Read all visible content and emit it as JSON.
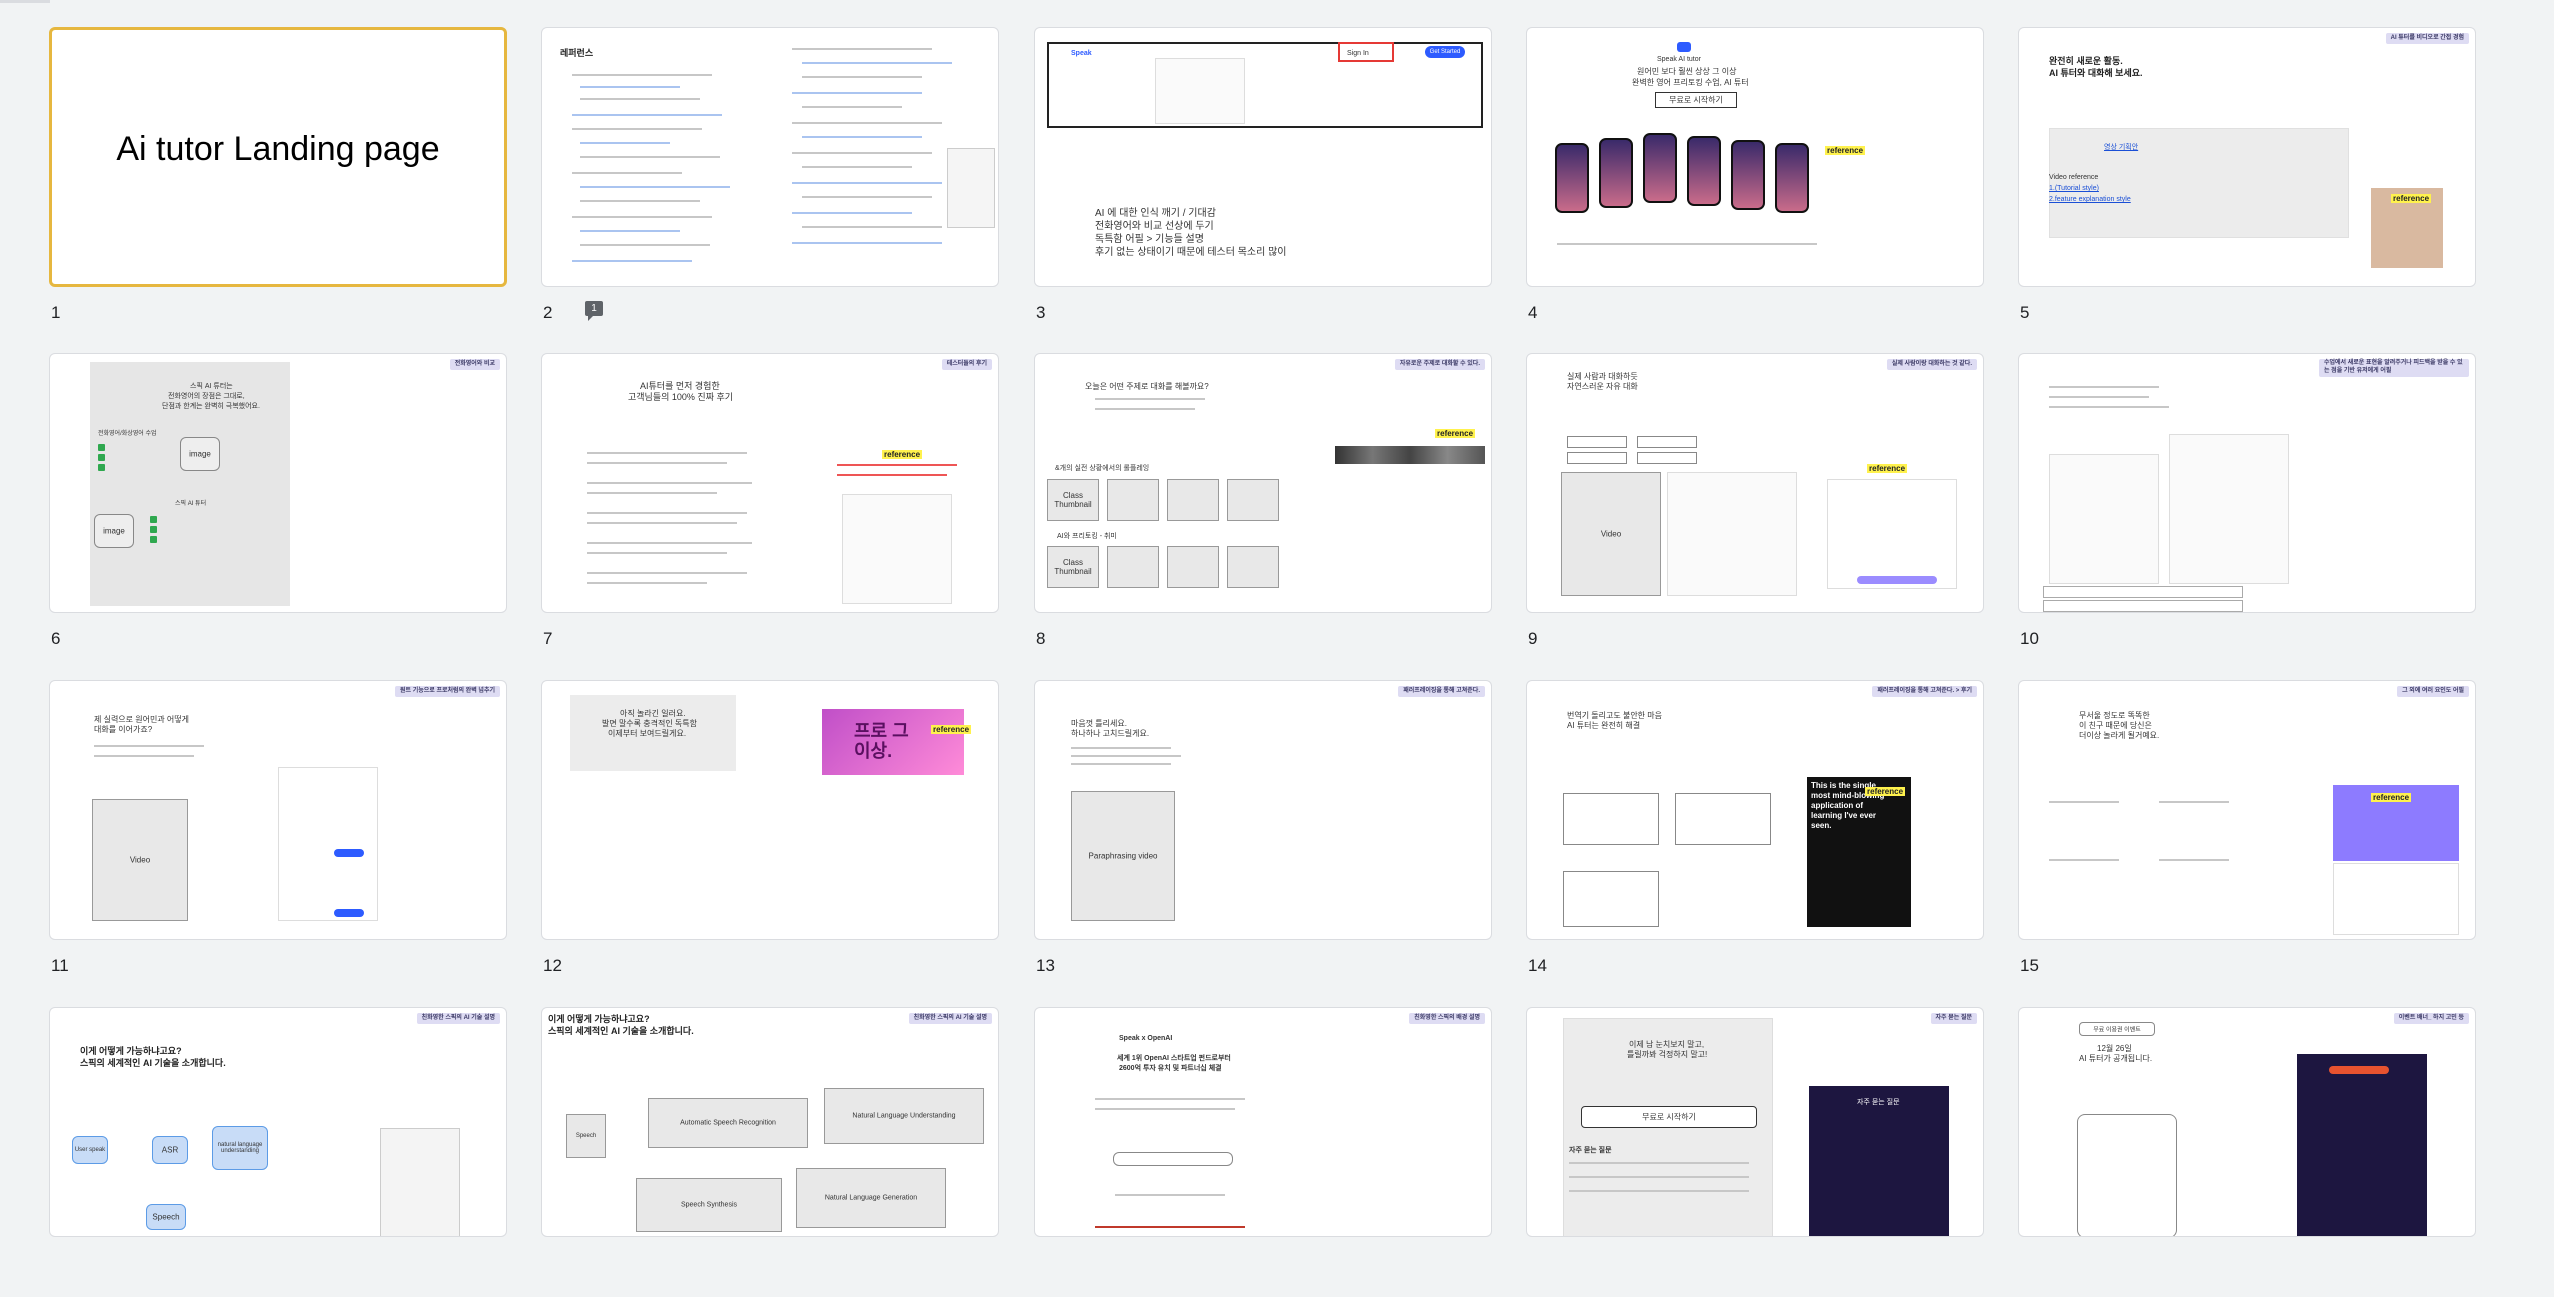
{
  "slides": [
    {
      "num": "1",
      "title": "Ai tutor Landing page"
    },
    {
      "num": "2",
      "heading": "레퍼런스",
      "comment_count": "1"
    },
    {
      "num": "3",
      "lines": [
        "AI 에 대한 인식 깨기 / 기대감",
        "전화영어와 비교 선상에 두기",
        "독특함 어필 > 기능들 설명",
        "후기 없는 상태이기 때문에 테스터 목소리 많이"
      ],
      "nav": [
        "Speak",
        "Sign In",
        "Get Started"
      ]
    },
    {
      "num": "4",
      "brand": "Speak AI tutor",
      "headline1": "원어민 보다 훨씬 상상 그 이상",
      "headline2": "완벽한 영어 프리토킹 수업, AI 튜터",
      "cta": "무료로 시작하기",
      "ref": "reference"
    },
    {
      "num": "5",
      "tag": "AI 튜터를 비디오로 간접 경험",
      "h1": "완전히 새로운 활동.",
      "h2": "AI 튜터와 대화해 보세요.",
      "video_link": "영상 기획안",
      "video_ref": "Video reference",
      "ref1": "1.(Tutorial style)",
      "ref2": "2.feature explanation style",
      "ref": "reference"
    },
    {
      "num": "6",
      "tag": "전화영어와 비교",
      "h1": "스픽 AI 튜터는",
      "h2": "전화영어의 장점은 그대로,",
      "h3": "단점과 한계는 완벽히 극복했어요.",
      "sub1": "전화영어/화상영어 수업",
      "sub2": "스픽 AI 튜터",
      "image": "image"
    },
    {
      "num": "7",
      "tag": "테스터들의 후기",
      "h1": "AI튜터를 먼저 경험한",
      "h2": "고객님들의 100% 진짜 후기",
      "ref": "reference"
    },
    {
      "num": "8",
      "tag": "자유로운 주제로 대화할 수 있다.",
      "h1": "오늘은 어떤 주제로 대화를 해볼까요?",
      "sub": "&개의 실전 상황에서의 롤플레잉",
      "sub2": "AI와 프리토킹 - 취미",
      "thumb": "Class Thumbnail",
      "ref": "reference"
    },
    {
      "num": "9",
      "tag": "실제 사람이랑 대화하는 것 같다.",
      "h1": "실제 사람과 대화하듯",
      "h2": "자연스러운 자유 대화",
      "video": "Video",
      "ref": "reference"
    },
    {
      "num": "10",
      "tag": "수업에서 새로운 표현을 알려주거나 피드백을 받을 수 있는 점을 기반 유저에게 어필"
    },
    {
      "num": "11",
      "tag": "원트 기능으로 프로처럼의 완벽 넘추기",
      "h1": "제 실력으로 원어민과 어떻게",
      "h2": "대화를 이어가죠?",
      "video": "Video"
    },
    {
      "num": "12",
      "h1": "아직 놀라긴 일러요.",
      "h2": "발면 말수록 충격적인 독특함",
      "h3": "이제부터 보여드릴게요.",
      "promo": "프로 그 이상.",
      "ref": "reference"
    },
    {
      "num": "13",
      "tag": "패러프레이징을 통해 고쳐준다.",
      "h1": "마음껏 틀리세요.",
      "h2": "하나하나 고치드릴게요.",
      "video": "Paraphrasing video"
    },
    {
      "num": "14",
      "tag": "패러프레이징을 통해 고쳐준다. > 후기",
      "h1": "번역기 돌리고도 불안한 마음",
      "h2": "AI 튜터는 완전히 해결",
      "dark_text": "This is the single most mind-blowing application of learning I've ever seen.",
      "ref": "reference"
    },
    {
      "num": "15",
      "tag": "그 외에 여러 요인도 어필",
      "h1": "무서울 정도로 똑똑한",
      "h2": "이 친구 때문에 당신은",
      "h3": "더이상 놀라게 될거예요.",
      "ref": "reference"
    },
    {
      "num": "16",
      "tag": "친화영한 스픽의 AI 기술 설명",
      "h1": "이게 어떻게 가능하냐고요?",
      "h2": "스픽의 세계적인 AI 기술을 소개합니다.",
      "asr": "ASR",
      "user": "User speak",
      "speech": "Speech",
      "nlu": "natural language understanding"
    },
    {
      "num": "17",
      "tag": "친화영한 스픽의 AI 기술 설명",
      "h1": "이게 어떻게 가능하냐고요?",
      "h2": "스픽의 세계적인 AI 기술을 소개합니다.",
      "b1": "Automatic Speech Recognition",
      "b2": "Natural Language Understanding",
      "b3": "Speech Synthesis",
      "b4": "Natural Language Generation",
      "b5": "Speech"
    },
    {
      "num": "18",
      "tag": "친화영한 스픽의 배경 설명",
      "brand": "Speak x OpenAI",
      "h1": "세계 1위 OpenAI 스타트업 펀드로부터",
      "h2": "2600억 투자 유치 및 파트너십 체결"
    },
    {
      "num": "19",
      "tag": "자주 묻는 질문",
      "h1": "이제 남 눈치보지 말고,",
      "h2": "틀릴까봐 걱정하지 말고!",
      "cta": "무료로 시작하기",
      "faq": "자주 묻는 질문"
    },
    {
      "num": "20",
      "tag": "이벤트 배너_ 하지 고민 등",
      "btn": "무료 이용권 이벤트",
      "h1": "12월 26일",
      "h2": "AI 튜터가 공개됩니다."
    }
  ],
  "colors": {
    "selected_border": "#e6b73f",
    "tag_bg": "#dedcf3",
    "highlight": "#fff24d",
    "link": "#1a4fd6"
  }
}
